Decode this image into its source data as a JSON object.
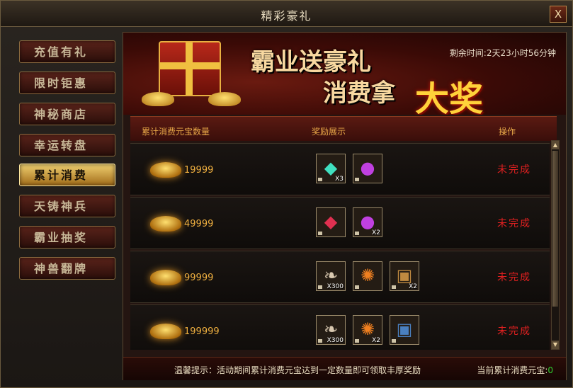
{
  "window": {
    "title": "精彩豪礼",
    "close_label": "X"
  },
  "sidebar": {
    "items": [
      {
        "label": "充值有礼"
      },
      {
        "label": "限时钜惠"
      },
      {
        "label": "神秘商店"
      },
      {
        "label": "幸运转盘"
      },
      {
        "label": "累计消费",
        "active": true
      },
      {
        "label": "天铸神兵"
      },
      {
        "label": "霸业抽奖"
      },
      {
        "label": "神兽翻牌"
      }
    ]
  },
  "banner": {
    "slogan_line1": "霸业送豪礼",
    "slogan_line2": "消费拿",
    "slogan_big": "大奖",
    "countdown_label": "剩余时间:",
    "countdown_value": "2天23小时56分钟"
  },
  "table": {
    "col_amount": "累计消费元宝数量",
    "col_rewards": "奖励展示",
    "col_action": "操作",
    "rows": [
      {
        "amount": "19999",
        "status": "未完成",
        "rewards": [
          {
            "icon": "green-crystal-icon",
            "qty": "X3"
          },
          {
            "icon": "purple-orb-icon",
            "qty": ""
          }
        ]
      },
      {
        "amount": "49999",
        "status": "未完成",
        "rewards": [
          {
            "icon": "red-crystal-icon",
            "qty": ""
          },
          {
            "icon": "purple-orb-icon",
            "qty": "X2"
          }
        ]
      },
      {
        "amount": "99999",
        "status": "未完成",
        "rewards": [
          {
            "icon": "feather-icon",
            "qty": "X300"
          },
          {
            "icon": "fire-orb-icon",
            "qty": ""
          },
          {
            "icon": "treasure-chest-icon",
            "qty": "X2"
          }
        ]
      },
      {
        "amount": "199999",
        "status": "未完成",
        "rewards": [
          {
            "icon": "feather-icon",
            "qty": "X300"
          },
          {
            "icon": "fire-orb-icon",
            "qty": "X2"
          },
          {
            "icon": "blue-chest-icon",
            "qty": ""
          }
        ]
      }
    ]
  },
  "footer": {
    "tip": "温馨提示：活动期间累计消费元宝达到一定数量即可领取丰厚奖励",
    "current_label": "当前累计消费元宝:",
    "current_value": "0"
  },
  "colors": {
    "accent_gold": "#f0b040",
    "status_red": "#e02020",
    "value_green": "#30d030"
  }
}
